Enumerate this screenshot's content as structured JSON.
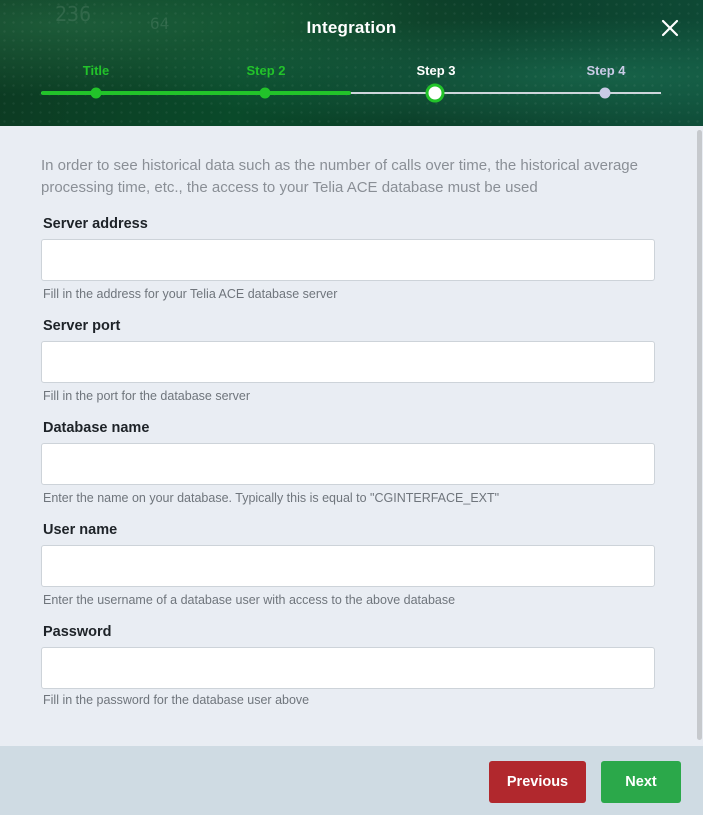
{
  "dialog": {
    "title": "Integration"
  },
  "stepper": {
    "steps": [
      {
        "label": "Title",
        "state": "done"
      },
      {
        "label": "Step 2",
        "state": "done"
      },
      {
        "label": "Step 3",
        "state": "active"
      },
      {
        "label": "Step 4",
        "state": "todo"
      }
    ]
  },
  "form": {
    "intro": "In order to see historical data such as the number of calls over time, the historical average processing time, etc., the access to your Telia ACE database must be used",
    "fields": [
      {
        "label": "Server address",
        "value": "",
        "help": "Fill in the address for your Telia ACE database server"
      },
      {
        "label": "Server port",
        "value": "",
        "help": "Fill in the port for the database server"
      },
      {
        "label": "Database name",
        "value": "",
        "help": "Enter the name on your database. Typically this is equal to \"CGINTERFACE_EXT\""
      },
      {
        "label": "User name",
        "value": "",
        "help": "Enter the username of a database user with access to the above database"
      },
      {
        "label": "Password",
        "value": "",
        "help": "Fill in the password for the database user above"
      }
    ]
  },
  "footer": {
    "previous_label": "Previous",
    "next_label": "Next"
  },
  "colors": {
    "accent_green": "#22c32a",
    "previous_button": "#b1282d",
    "next_button": "#2ba84a"
  },
  "icons": {
    "close": "close-icon"
  }
}
